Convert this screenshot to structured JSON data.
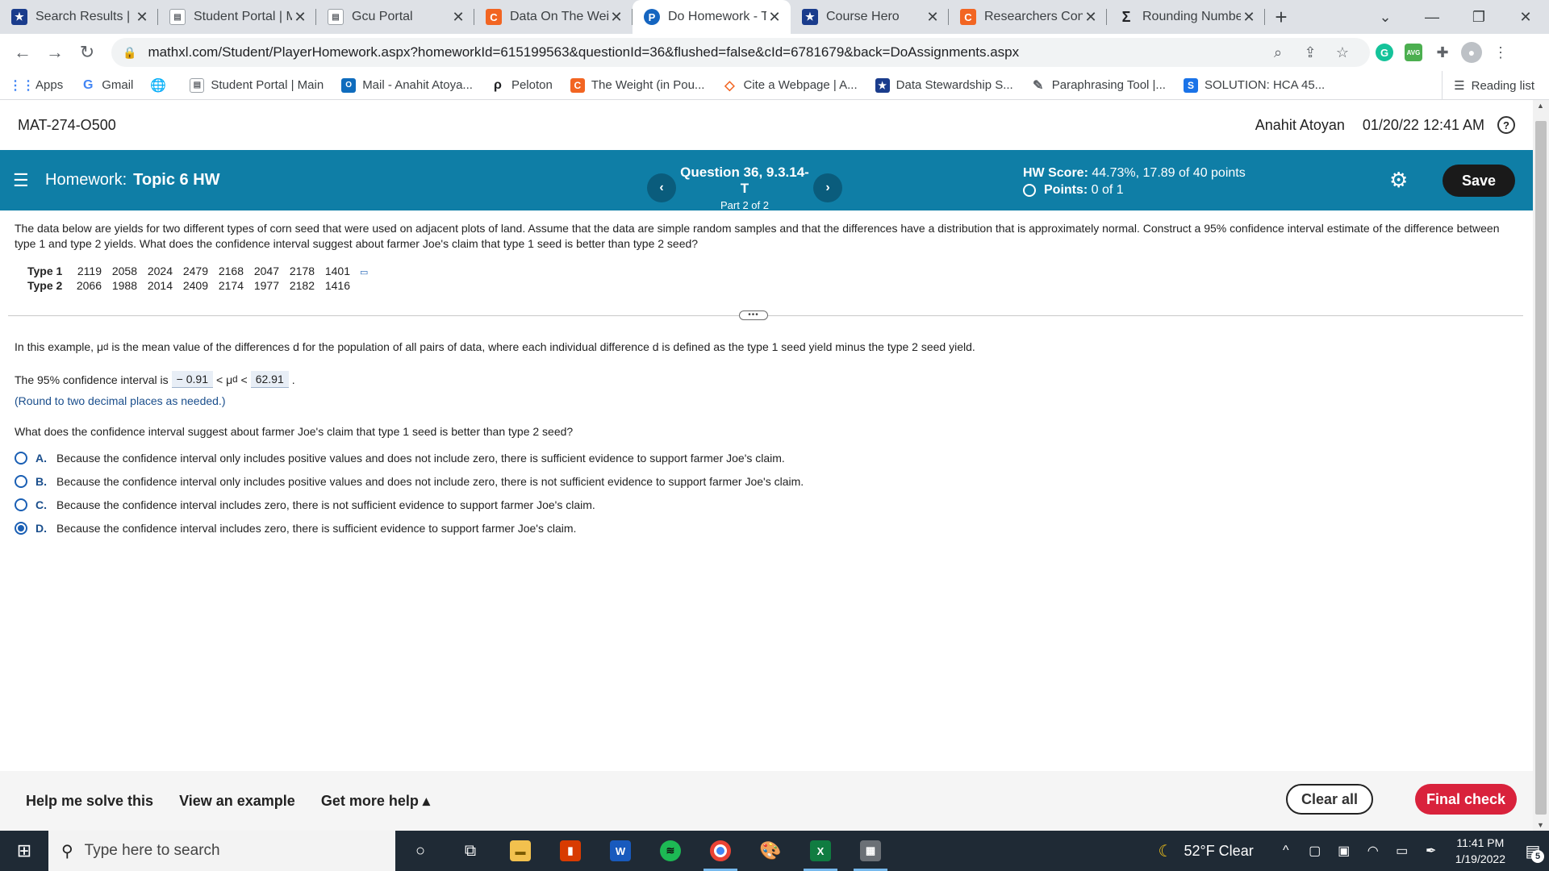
{
  "browser": {
    "tabs": [
      {
        "title": "Search Results | C",
        "icon": "star-badge-icon",
        "active": false
      },
      {
        "title": "Student Portal | M",
        "icon": "document-icon",
        "active": false
      },
      {
        "title": "Gcu Portal",
        "icon": "document-icon",
        "active": false
      },
      {
        "title": "Data On The Wei",
        "icon": "chegg-c-icon",
        "active": false
      },
      {
        "title": "Do Homework - T",
        "icon": "pearson-p-icon",
        "active": true
      },
      {
        "title": "Course Hero",
        "icon": "star-badge-icon",
        "active": false
      },
      {
        "title": "Researchers Conc",
        "icon": "chegg-c-icon",
        "active": false
      },
      {
        "title": "Rounding Numbe",
        "icon": "sigma-icon",
        "active": false
      }
    ],
    "url": "mathxl.com/Student/PlayerHomework.aspx?homeworkId=615199563&questionId=36&flushed=false&cId=6781679&back=DoAssignments.aspx",
    "bookmarks": [
      {
        "label": "Apps",
        "icon": "apps-grid-icon"
      },
      {
        "label": "Gmail",
        "icon": "google-g-icon"
      },
      {
        "label": "",
        "icon": "globe-icon"
      },
      {
        "label": "Student Portal | Main",
        "icon": "document-icon"
      },
      {
        "label": "Mail - Anahit Atoya...",
        "icon": "outlook-icon"
      },
      {
        "label": "Peloton",
        "icon": "peloton-icon"
      },
      {
        "label": "The Weight (in Pou...",
        "icon": "chegg-c-icon"
      },
      {
        "label": "Cite a Webpage | A...",
        "icon": "cite-icon"
      },
      {
        "label": "Data Stewardship S...",
        "icon": "star-badge-icon"
      },
      {
        "label": "Paraphrasing Tool |...",
        "icon": "quill-icon"
      },
      {
        "label": "SOLUTION: HCA 45...",
        "icon": "studylib-s-icon"
      }
    ],
    "reading_list": "Reading list"
  },
  "header": {
    "course": "MAT-274-O500",
    "user": "Anahit Atoyan",
    "datetime": "01/20/22 12:41 AM"
  },
  "hw": {
    "label": "Homework:",
    "name": "Topic 6 HW",
    "question": "Question 36, 9.3.14-T",
    "part": "Part 2 of 2",
    "score_label": "HW Score:",
    "score_value": "44.73%, 17.89 of 40 points",
    "points_label": "Points:",
    "points_value": "0 of 1",
    "save": "Save"
  },
  "problem": {
    "text": "The data below are yields for two different types of corn seed that were used on adjacent plots of land. Assume that the data are simple random samples and that the differences have a distribution that is approximately normal. Construct a 95% confidence interval estimate of the difference between type 1 and type 2 yields. What does the confidence interval suggest about farmer Joe's claim that type 1 seed is better than type 2 seed?",
    "rows": [
      {
        "label": "Type 1",
        "values": [
          "2119",
          "2058",
          "2024",
          "2479",
          "2168",
          "2047",
          "2178",
          "1401"
        ]
      },
      {
        "label": "Type 2",
        "values": [
          "2066",
          "1988",
          "2014",
          "2409",
          "2174",
          "1977",
          "2182",
          "1416"
        ]
      }
    ]
  },
  "part2": {
    "example_pre": "In this example, ",
    "mu": "μ",
    "sub": "d",
    "example_post": " is the mean value of the differences d for the population of all pairs of data, where each individual difference d is defined as the type 1 seed yield minus the type 2 seed yield.",
    "ci_pre": "The 95% confidence interval is",
    "ci_low": "− 0.91",
    "lt": "<",
    "ci_high": "62.91",
    "ci_end": ".",
    "round_note": "(Round to two decimal places as needed.)",
    "question": "What does the confidence interval suggest about farmer Joe's claim that type 1 seed is better than type 2 seed?",
    "choices": [
      {
        "letter": "A.",
        "text": "Because the confidence interval only includes positive values and does not include zero, there is sufficient evidence to support farmer Joe's claim.",
        "selected": false
      },
      {
        "letter": "B.",
        "text": "Because the confidence interval only includes positive values and does not include zero, there is not sufficient evidence to support farmer Joe's claim.",
        "selected": false
      },
      {
        "letter": "C.",
        "text": "Because the confidence interval includes zero, there is not sufficient evidence to support farmer Joe's claim.",
        "selected": false
      },
      {
        "letter": "D.",
        "text": "Because the confidence interval includes zero, there is sufficient evidence to support farmer Joe's claim.",
        "selected": true
      }
    ]
  },
  "footer": {
    "help": "Help me solve this",
    "example": "View an example",
    "more": "Get more help ▴",
    "clear": "Clear all",
    "final": "Final check"
  },
  "taskbar": {
    "search_placeholder": "Type here to search",
    "weather": "52°F  Clear",
    "time": "11:41 PM",
    "date": "1/19/2022",
    "notifications": "5"
  },
  "colors": {
    "accent": "#0f7ea6",
    "final_check": "#d9223c",
    "link_blue": "#1a4e8c"
  }
}
